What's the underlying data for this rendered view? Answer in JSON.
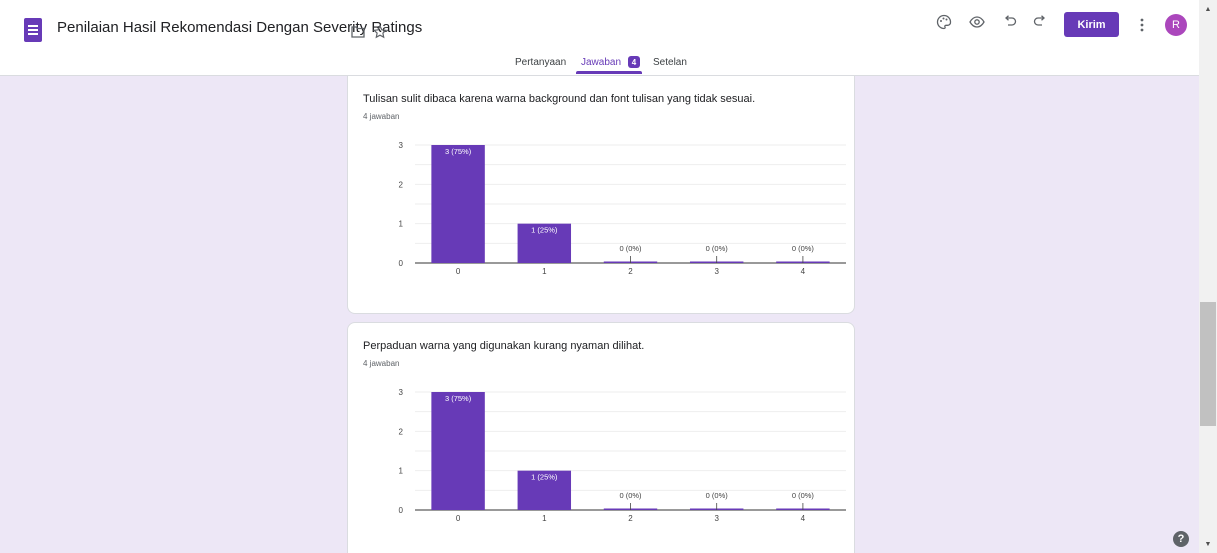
{
  "header": {
    "title": "Penilaian Hasil Rekomendasi Dengan Severity Ratings",
    "send_label": "Kirim",
    "avatar_initial": "R",
    "icons": [
      "folder-icon",
      "star-icon",
      "palette-icon",
      "preview-icon",
      "undo-icon",
      "redo-icon",
      "more-vert-icon"
    ]
  },
  "tabs": [
    {
      "label": "Pertanyaan",
      "active": false
    },
    {
      "label": "Jawaban",
      "active": true,
      "badge": "4"
    },
    {
      "label": "Setelan",
      "active": false
    }
  ],
  "questions": [
    {
      "title": "Tulisan sulit dibaca karena warna background dan font tulisan yang tidak sesuai.",
      "count_label": "4 jawaban"
    },
    {
      "title": "Perpaduan warna yang digunakan kurang nyaman dilihat.",
      "count_label": "4 jawaban"
    }
  ],
  "chart_data": [
    {
      "type": "bar",
      "categories": [
        "0",
        "1",
        "2",
        "3",
        "4"
      ],
      "values": [
        3,
        1,
        0,
        0,
        0
      ],
      "data_labels": [
        "3 (75%)",
        "1 (25%)",
        "0 (0%)",
        "0 (0%)",
        "0 (0%)"
      ],
      "ylim": [
        0,
        3
      ],
      "yticks": [
        "0",
        "1",
        "2",
        "3"
      ],
      "grid": true,
      "color": "#673ab7"
    },
    {
      "type": "bar",
      "categories": [
        "0",
        "1",
        "2",
        "3",
        "4"
      ],
      "values": [
        3,
        1,
        0,
        0,
        0
      ],
      "data_labels": [
        "3 (75%)",
        "1 (25%)",
        "0 (0%)",
        "0 (0%)",
        "0 (0%)"
      ],
      "ylim": [
        0,
        3
      ],
      "yticks": [
        "0",
        "1",
        "2",
        "3"
      ],
      "grid": true,
      "color": "#673ab7"
    }
  ],
  "help_label": "?",
  "colors": {
    "accent": "#673ab7",
    "background": "#ede7f6",
    "avatar": "#ab47bc"
  }
}
